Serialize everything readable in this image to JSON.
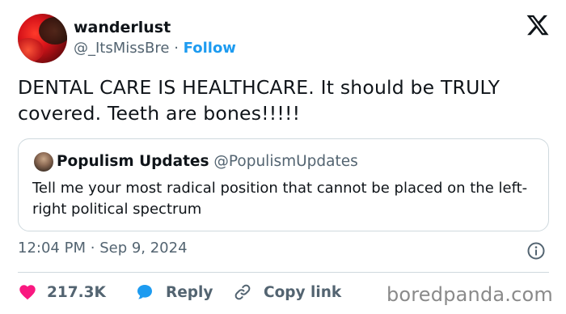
{
  "author": {
    "display_name": "wanderlust",
    "handle": "@_ItsMissBre",
    "separator": "·",
    "follow_label": "Follow"
  },
  "tweet": {
    "text": "DENTAL CARE IS HEALTHCARE. It should be TRULY covered. Teeth are bones!!!!!"
  },
  "quoted_tweet": {
    "display_name": "Populism Updates",
    "handle": "@PopulismUpdates",
    "text": "Tell me your most radical position that cannot be placed on the left-right political spectrum"
  },
  "meta": {
    "time": "12:04 PM",
    "separator": "·",
    "date": "Sep 9, 2024"
  },
  "actions": {
    "like_count": "217.3K",
    "reply_label": "Reply",
    "copy_label": "Copy link"
  },
  "watermark": "boredpanda.com",
  "icons": {
    "logo": "x-logo-icon",
    "info": "info-icon",
    "like": "heart-icon",
    "reply": "speech-bubble-icon",
    "copy": "link-icon"
  },
  "colors": {
    "accent": "#1d9bf0",
    "heart": "#f91880",
    "text_primary": "#0f1419",
    "text_secondary": "#536471",
    "border": "#cfd9de"
  }
}
